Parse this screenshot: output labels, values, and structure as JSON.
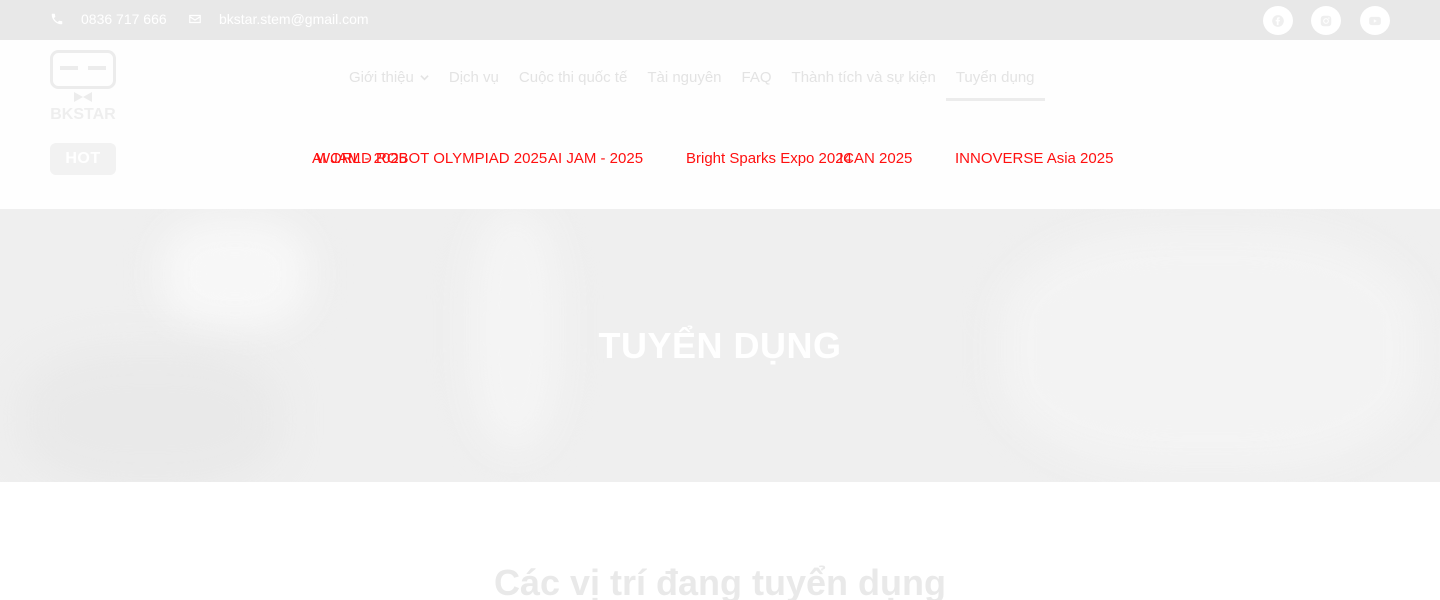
{
  "topbar": {
    "phone": "0836 717 666",
    "email": "bkstar.stem@gmail.com",
    "social": [
      "facebook-icon",
      "instagram-icon",
      "youtube-icon"
    ]
  },
  "logo": {
    "text": "BKSTAR"
  },
  "nav": {
    "items": [
      {
        "label": "Giới thiệu",
        "has_dropdown": true
      },
      {
        "label": "Dịch vụ"
      },
      {
        "label": "Cuộc thi quốc tế"
      },
      {
        "label": "Tài nguyên"
      },
      {
        "label": "FAQ"
      },
      {
        "label": "Thành tích và sự kiện"
      },
      {
        "label": "Tuyển dụng",
        "active": true
      }
    ]
  },
  "hot": {
    "label": "HOT",
    "items": [
      "AI JAM - 2025",
      "WORLD ROBOT OLYMPIAD 2025",
      "AI JAM - 2025",
      "Bright Sparks Expo 2024",
      "ICAN 2025",
      "INNOVERSE Asia 2025"
    ]
  },
  "hero": {
    "title": "TUYỂN DỤNG"
  },
  "section": {
    "title": "Các vị trí đang tuyển dụng"
  },
  "colors": {
    "hot_text": "#ff1010",
    "topbar_bg": "#e8e8e8"
  }
}
